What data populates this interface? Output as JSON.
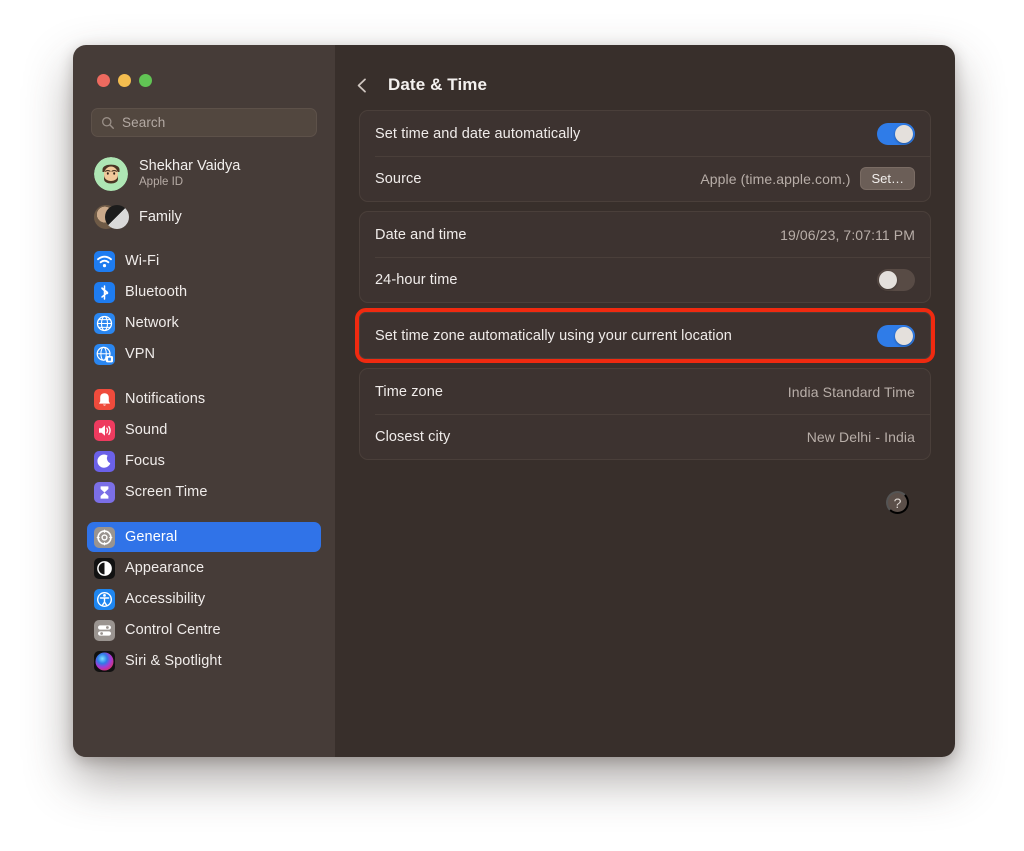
{
  "window": {
    "traffic_lights": [
      "close",
      "minimize",
      "zoom"
    ]
  },
  "sidebar": {
    "search": {
      "placeholder": "Search",
      "value": ""
    },
    "account": {
      "name": "Shekhar Vaidya",
      "subtitle": "Apple ID"
    },
    "family": {
      "label": "Family"
    },
    "groups": [
      {
        "items": [
          {
            "label": "Wi-Fi",
            "icon": "wifi-icon"
          },
          {
            "label": "Bluetooth",
            "icon": "bluetooth-icon"
          },
          {
            "label": "Network",
            "icon": "network-icon"
          },
          {
            "label": "VPN",
            "icon": "vpn-icon"
          }
        ]
      },
      {
        "items": [
          {
            "label": "Notifications",
            "icon": "notifications-icon"
          },
          {
            "label": "Sound",
            "icon": "sound-icon"
          },
          {
            "label": "Focus",
            "icon": "focus-icon"
          },
          {
            "label": "Screen Time",
            "icon": "screen-time-icon"
          }
        ]
      },
      {
        "items": [
          {
            "label": "General",
            "icon": "general-icon",
            "selected": true
          },
          {
            "label": "Appearance",
            "icon": "appearance-icon"
          },
          {
            "label": "Accessibility",
            "icon": "accessibility-icon"
          },
          {
            "label": "Control Centre",
            "icon": "control-centre-icon"
          },
          {
            "label": "Siri & Spotlight",
            "icon": "siri-spotlight-icon"
          }
        ]
      }
    ]
  },
  "main": {
    "back_label": "Back",
    "title": "Date & Time",
    "cards": [
      {
        "rows": [
          {
            "label": "Set time and date automatically",
            "control": "toggle",
            "state": "on"
          },
          {
            "label": "Source",
            "value": "Apple (time.apple.com.)",
            "button": "Set…"
          }
        ]
      },
      {
        "rows": [
          {
            "label": "Date and time",
            "value": "19/06/23, 7:07:11 PM"
          },
          {
            "label": "24-hour time",
            "control": "toggle",
            "state": "off"
          }
        ]
      },
      {
        "highlighted": true,
        "highlight_color": "#f02a10",
        "rows": [
          {
            "label": "Set time zone automatically using your current location",
            "control": "toggle",
            "state": "on"
          }
        ]
      },
      {
        "rows": [
          {
            "label": "Time zone",
            "value": "India Standard Time"
          },
          {
            "label": "Closest city",
            "value": "New Delhi - India"
          }
        ]
      }
    ],
    "help_label": "?"
  },
  "colors": {
    "sidebar_bg": "#463c38",
    "main_bg": "#382f2b",
    "card_bg": "#3d3330",
    "accent_blue": "#2f7ce8",
    "highlight_red": "#f02a10"
  }
}
